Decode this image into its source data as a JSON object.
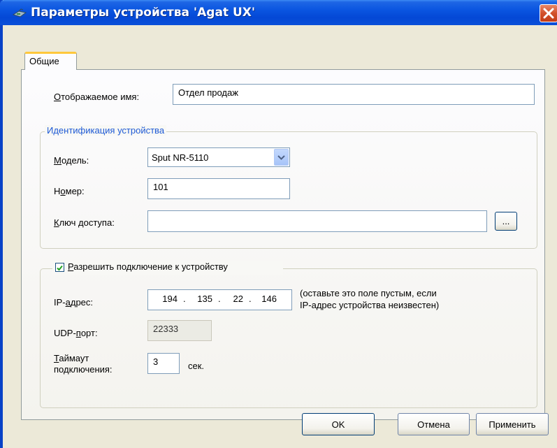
{
  "window": {
    "title": "Параметры устройства 'Agat UX'",
    "colors": {
      "titlebar": "#0a55e0",
      "close": "#d2502a",
      "tab_highlight": "#ffc83c",
      "group_title": "#1f5ad6"
    }
  },
  "tabs": [
    {
      "label": "Общие",
      "selected": true
    }
  ],
  "general": {
    "display_name_label": "Отображаемое имя:",
    "display_name_value": "Отдел продаж"
  },
  "identification": {
    "group_title": "Идентификация устройства",
    "model_label": "Модель:",
    "model_value": "Sput NR-5110",
    "number_label": "Номер:",
    "number_value": "101",
    "access_key_label": "Ключ доступа:",
    "access_key_value": "",
    "browse_label": "..."
  },
  "connection": {
    "enable_label": "Разрешить подключение к устройству",
    "enabled": true,
    "ip_label": "IP-адрес:",
    "ip_octets": [
      "194",
      "135",
      "22",
      "146"
    ],
    "ip_hint_line1": "(оставьте это поле пустым, если",
    "ip_hint_line2": "IP-адрес устройства неизвестен)",
    "udp_label": "UDP-порт:",
    "udp_value": "22333",
    "timeout_label_line1": "Таймаут",
    "timeout_label_line2": "подключения:",
    "timeout_value": "3",
    "timeout_unit": "сек."
  },
  "buttons": {
    "ok": "OK",
    "cancel": "Отмена",
    "apply": "Применить"
  }
}
